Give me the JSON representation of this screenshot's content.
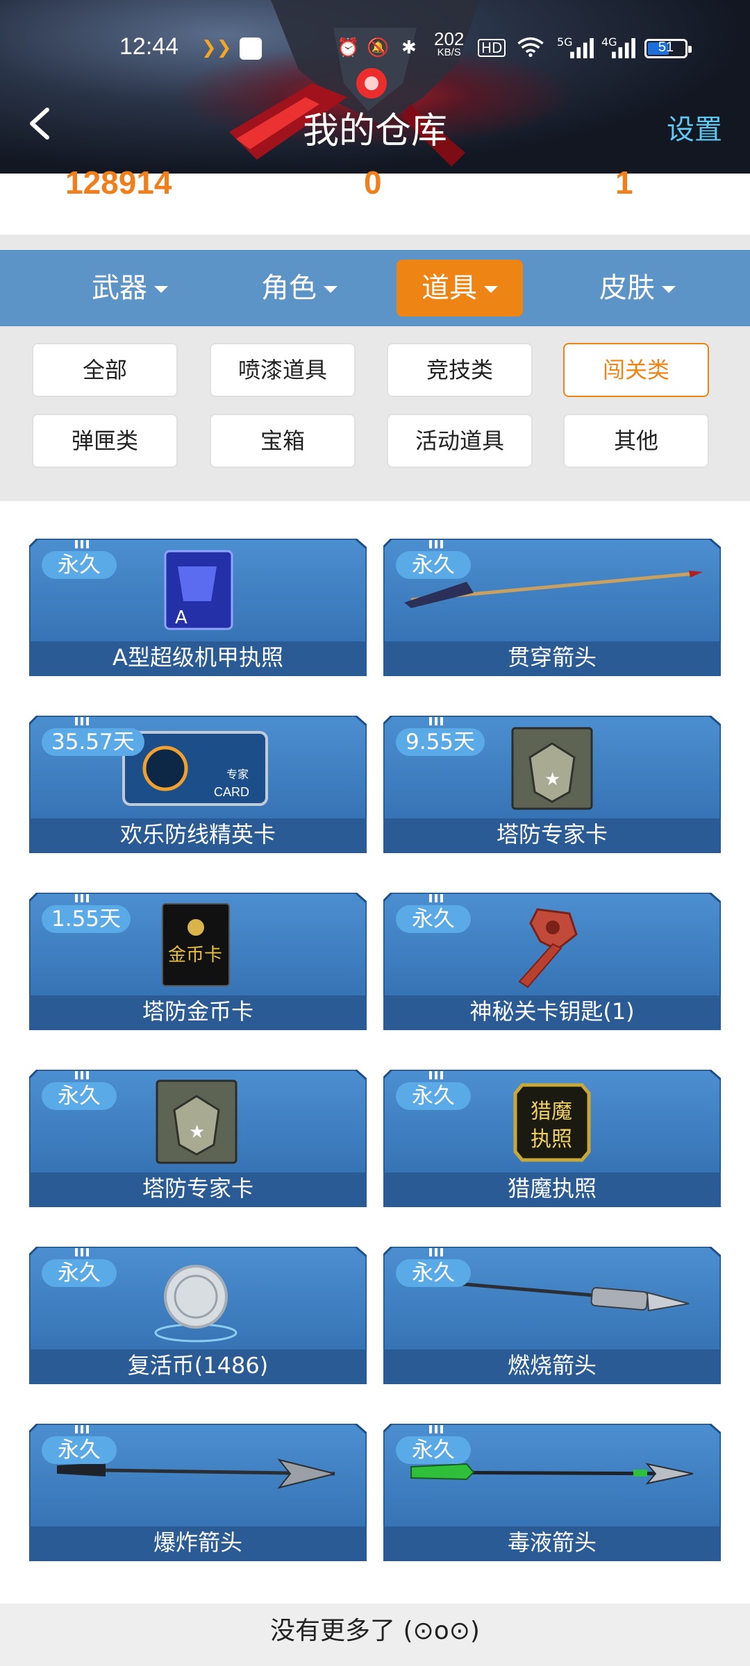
{
  "status_bar": {
    "time": "12:44",
    "net_speed_value": "202",
    "net_speed_unit": "KB/S",
    "hd_label": "HD",
    "signal1_label": "5G",
    "signal2_label": "4G",
    "battery": "51"
  },
  "header": {
    "title": "我的仓库",
    "settings_label": "设置"
  },
  "stats": {
    "values": [
      "128914",
      "0",
      "1"
    ]
  },
  "tabs": [
    {
      "label": "武器",
      "active": false
    },
    {
      "label": "角色",
      "active": false
    },
    {
      "label": "道具",
      "active": true
    },
    {
      "label": "皮肤",
      "active": false
    }
  ],
  "filters": [
    {
      "label": "全部",
      "active": false
    },
    {
      "label": "喷漆道具",
      "active": false
    },
    {
      "label": "竞技类",
      "active": false
    },
    {
      "label": "闯关类",
      "active": true
    },
    {
      "label": "弹匣类",
      "active": false
    },
    {
      "label": "宝箱",
      "active": false
    },
    {
      "label": "活动道具",
      "active": false
    },
    {
      "label": "其他",
      "active": false
    }
  ],
  "items": [
    {
      "name": "A型超级机甲执照",
      "duration": "永久",
      "icon": "mecha-license-icon"
    },
    {
      "name": "贯穿箭头",
      "duration": "永久",
      "icon": "arrow-icon"
    },
    {
      "name": "欢乐防线精英卡",
      "duration": "35.57天",
      "icon": "elite-card-icon",
      "card_text": [
        "专家",
        "CARD"
      ]
    },
    {
      "name": "塔防专家卡",
      "duration": "9.55天",
      "icon": "expert-card-icon"
    },
    {
      "name": "塔防金币卡",
      "duration": "1.55天",
      "icon": "gold-card-icon",
      "card_text": [
        "金币卡"
      ]
    },
    {
      "name": "神秘关卡钥匙(1)",
      "duration": "永久",
      "icon": "key-icon"
    },
    {
      "name": "塔防专家卡",
      "duration": "永久",
      "icon": "expert-card-icon"
    },
    {
      "name": "猎魔执照",
      "duration": "永久",
      "icon": "hunter-license-icon",
      "card_text": [
        "猎魔",
        "执照"
      ]
    },
    {
      "name": "复活币(1486)",
      "duration": "永久",
      "icon": "revive-coin-icon"
    },
    {
      "name": "燃烧箭头",
      "duration": "永久",
      "icon": "arrow-icon"
    },
    {
      "name": "爆炸箭头",
      "duration": "永久",
      "icon": "arrow-icon"
    },
    {
      "name": "毒液箭头",
      "duration": "永久",
      "icon": "arrow-icon"
    }
  ],
  "footer_text": "没有更多了 (⊙o⊙)",
  "colors": {
    "accent": "#ee8414",
    "tab_bar": "#5c94c8",
    "badge": "#5aaae8",
    "settings": "#5fc6f0"
  }
}
